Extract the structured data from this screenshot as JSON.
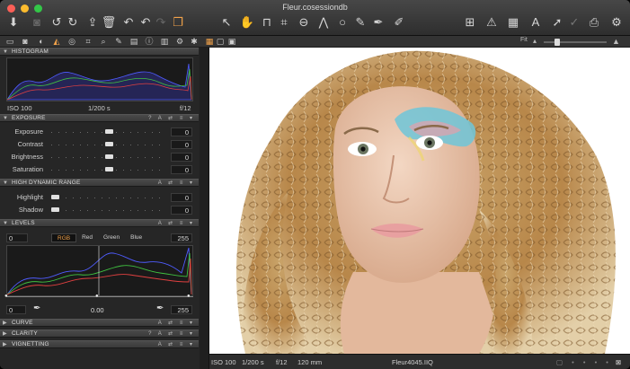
{
  "window": {
    "title": "Fleur.cosessiondb"
  },
  "colors": {
    "accent": "#f3a34a",
    "close": "#fc5f57",
    "minimize": "#fdbc2e",
    "zoom": "#33c748"
  },
  "toolbar": {
    "icons": [
      "import-icon",
      "camera-icon",
      "rotate-left-icon",
      "rotate-right-icon",
      "export-icon",
      "trash-icon",
      "undo-icon",
      "redo-left-icon",
      "redo-right-icon",
      "stack-icon",
      "cursor-icon",
      "pan-icon",
      "crop-icon",
      "straighten-icon",
      "keystone-icon",
      "circle-icon",
      "brush-icon",
      "eraser-icon",
      "picker-icon",
      "compare-icon",
      "warning-icon",
      "grid-icon",
      "text-icon",
      "arrow-icon",
      "check-icon",
      "print-icon",
      "gear-icon"
    ],
    "fit_label": "Fit"
  },
  "histogram": {
    "title": "HISTOGRAM",
    "iso": "ISO 100",
    "shutter": "1/200 s",
    "aperture": "f/12"
  },
  "exposure": {
    "title": "EXPOSURE",
    "controls": "? A ⇄ ≡ ▾",
    "rows": [
      {
        "label": "Exposure",
        "value": "0",
        "pos": 0.5
      },
      {
        "label": "Contrast",
        "value": "0",
        "pos": 0.5
      },
      {
        "label": "Brightness",
        "value": "0",
        "pos": 0.5
      },
      {
        "label": "Saturation",
        "value": "0",
        "pos": 0.5
      }
    ]
  },
  "hdr": {
    "title": "HIGH DYNAMIC RANGE",
    "controls": "A ⇄ ≡ ▾",
    "rows": [
      {
        "label": "Highlight",
        "value": "0",
        "pos": 0.0
      },
      {
        "label": "Shadow",
        "value": "0",
        "pos": 0.0
      }
    ]
  },
  "levels": {
    "title": "LEVELS",
    "controls": "A ⇄ ≡ ▾",
    "low_input": "0",
    "high_input": "255",
    "channels": [
      "RGB",
      "Red",
      "Green",
      "Blue"
    ],
    "active_channel": "RGB",
    "low_output": "0",
    "mid": "0.00",
    "high_output": "255"
  },
  "collapsed": [
    {
      "title": "CURVE",
      "controls": "A ⇄ ≡ ▾"
    },
    {
      "title": "CLARITY",
      "controls": "? A ⇄ ≡ ▾"
    },
    {
      "title": "VIGNETTING",
      "controls": "A ⇄ ≡ ▾"
    }
  ],
  "status": {
    "iso": "ISO 100",
    "shutter": "1/200 s",
    "aperture": "f/12",
    "focal": "120 mm",
    "filename": "Fleur4045.IIQ"
  }
}
